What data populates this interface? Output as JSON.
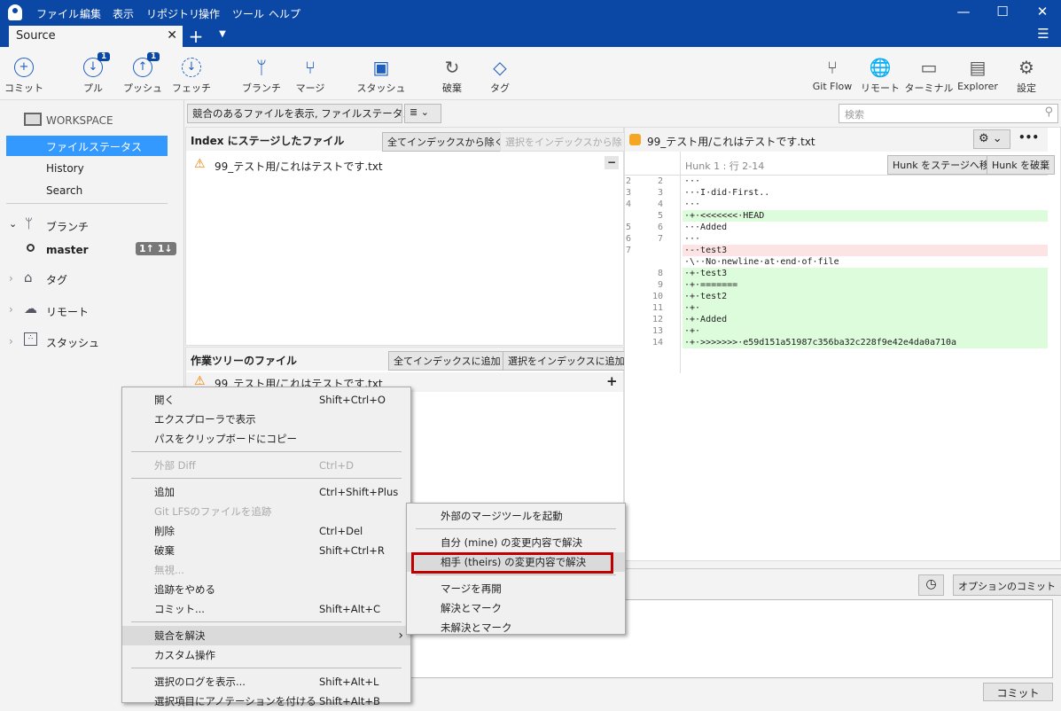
{
  "menubar": [
    "ファイル",
    "編集",
    "表示",
    "リポジトリ",
    "操作",
    "ツール",
    "ヘルプ"
  ],
  "tab": {
    "label": "Source"
  },
  "toolbar": [
    {
      "label": "コミット",
      "icon": "plus-circle-icon"
    },
    {
      "label": "プル",
      "icon": "pull-icon",
      "badge": "1"
    },
    {
      "label": "プッシュ",
      "icon": "push-icon",
      "badge": "1"
    },
    {
      "label": "フェッチ",
      "icon": "fetch-icon"
    },
    {
      "label": "ブランチ",
      "icon": "branch-icon"
    },
    {
      "label": "マージ",
      "icon": "merge-icon"
    },
    {
      "label": "スタッシュ",
      "icon": "stash-icon"
    },
    {
      "label": "破棄",
      "icon": "discard-icon"
    },
    {
      "label": "タグ",
      "icon": "tag-icon"
    },
    {
      "label": "Git Flow",
      "icon": "git-flow-icon"
    },
    {
      "label": "リモート",
      "icon": "globe-icon"
    },
    {
      "label": "ターミナル",
      "icon": "terminal-icon"
    },
    {
      "label": "Explorer",
      "icon": "folder-icon"
    },
    {
      "label": "設定",
      "icon": "gear-icon"
    }
  ],
  "sidebar": {
    "workspace": "WORKSPACE",
    "items": [
      "ファイルステータス",
      "History",
      "Search"
    ],
    "branches": "ブランチ",
    "branch": "master",
    "branch_status": "1↑ 1↓",
    "tags": "タグ",
    "remotes": "リモート",
    "stashes": "スタッシュ"
  },
  "filter": {
    "selected": "競合のあるファイルを表示, ファイルステータス順",
    "view": "≣"
  },
  "search": {
    "placeholder": "検索"
  },
  "staged": {
    "title": "Index にステージしたファイル",
    "remove_all": "全てインデックスから除く",
    "remove_selected": "選択をインデックスから除く",
    "files": [
      "99_テスト用/これはテストです.txt"
    ]
  },
  "working": {
    "title": "作業ツリーのファイル",
    "add_all": "全てインデックスに追加",
    "add_selected": "選択をインデックスに追加",
    "files": [
      "99_テスト用/これはテストです.txt"
    ]
  },
  "diff": {
    "file": "99_テスト用/これはテストです.txt",
    "hunk": "Hunk 1 : 行 2-14",
    "stage_hunk": "Hunk をステージへ移動",
    "discard_hunk": "Hunk を破棄",
    "lines": [
      {
        "o": "2",
        "n": "2",
        "t": "···",
        "k": ""
      },
      {
        "o": "3",
        "n": "3",
        "t": "···I·did·First..",
        "k": ""
      },
      {
        "o": "4",
        "n": "4",
        "t": "···",
        "k": ""
      },
      {
        "o": "",
        "n": "5",
        "t": "·+·<<<<<<<·HEAD",
        "k": "add"
      },
      {
        "o": "5",
        "n": "6",
        "t": "···Added",
        "k": ""
      },
      {
        "o": "6",
        "n": "7",
        "t": "···",
        "k": ""
      },
      {
        "o": "7",
        "n": "",
        "t": "·-·test3",
        "k": "del"
      },
      {
        "o": "",
        "n": "",
        "t": "·\\··No·newline·at·end·of·file",
        "k": ""
      },
      {
        "o": "",
        "n": "8",
        "t": "·+·test3",
        "k": "add"
      },
      {
        "o": "",
        "n": "9",
        "t": "·+·=======",
        "k": "add"
      },
      {
        "o": "",
        "n": "10",
        "t": "·+·test2",
        "k": "add"
      },
      {
        "o": "",
        "n": "11",
        "t": "·+·",
        "k": "add"
      },
      {
        "o": "",
        "n": "12",
        "t": "·+·Added",
        "k": "add"
      },
      {
        "o": "",
        "n": "13",
        "t": "·+·",
        "k": "add"
      },
      {
        "o": "",
        "n": "14",
        "t": "·+·>>>>>>>·e59d151a51987c356ba32c228f9e42e4da0a710a",
        "k": "add"
      }
    ]
  },
  "commit": {
    "options": "オプションのコミット",
    "button": "コミット"
  },
  "context_menu": [
    {
      "l": "開く",
      "s": "Shift+Ctrl+O"
    },
    {
      "l": "エクスプローラで表示",
      "s": ""
    },
    {
      "l": "パスをクリップボードにコピー",
      "s": ""
    },
    {
      "sep": true
    },
    {
      "l": "外部 Diff",
      "s": "Ctrl+D",
      "dis": true
    },
    {
      "sep": true
    },
    {
      "l": "追加",
      "s": "Ctrl+Shift+Plus"
    },
    {
      "l": "Git LFSのファイルを追跡",
      "s": "",
      "dis": true
    },
    {
      "l": "削除",
      "s": "Ctrl+Del"
    },
    {
      "l": "破棄",
      "s": "Shift+Ctrl+R"
    },
    {
      "l": "無視...",
      "s": "",
      "dis": true
    },
    {
      "l": "追跡をやめる",
      "s": ""
    },
    {
      "l": "コミット...",
      "s": "Shift+Alt+C"
    },
    {
      "sep": true
    },
    {
      "l": "競合を解決",
      "s": "",
      "sub": true
    },
    {
      "l": "カスタム操作",
      "s": ""
    },
    {
      "sep": true
    },
    {
      "l": "選択のログを表示...",
      "s": "Shift+Alt+L"
    },
    {
      "l": "選択項目にアノテーションを付ける",
      "s": "Shift+Alt+B"
    }
  ],
  "submenu": [
    {
      "l": "外部のマージツールを起動"
    },
    {
      "sep": true
    },
    {
      "l": "自分 (mine) の変更内容で解決"
    },
    {
      "l": "相手 (theirs) の変更内容で解決",
      "hl": true
    },
    {
      "sep": true
    },
    {
      "l": "マージを再開"
    },
    {
      "l": "解決とマーク"
    },
    {
      "l": "未解決とマーク"
    }
  ],
  "colors": {
    "title": "#0b47a4",
    "selection": "#3399ff",
    "highlight_box": "#c00000"
  }
}
